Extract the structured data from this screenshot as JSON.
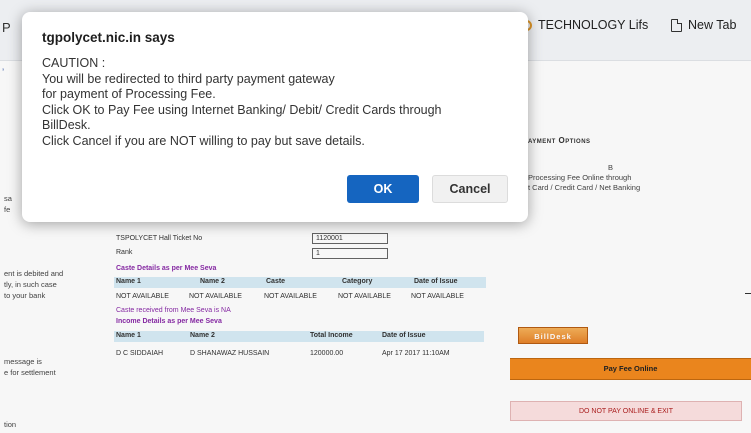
{
  "browser": {
    "left_fragment": "P",
    "left_fragment2": "ʼ",
    "bookmarks": [
      {
        "label": "TECHNOLOGY Lifs",
        "icon": "circle-icon"
      },
      {
        "label": "New Tab",
        "icon": "document-icon"
      }
    ]
  },
  "dialog": {
    "title": "tgpolycet.nic.in says",
    "lines": [
      "CAUTION :",
      "You will be redirected to third party payment gateway",
      "for payment of Processing Fee.",
      "Click OK to Pay Fee using Internet Banking/ Debit/ Credit Cards through",
      "BillDesk.",
      "Click Cancel if you are NOT willing to pay but save details."
    ],
    "ok_label": "OK",
    "cancel_label": "Cancel"
  },
  "page": {
    "payment_options_heading": "ayment Options",
    "payment_note": [
      "B",
      "Processing Fee Online through",
      "t Card / Credit Card / Net Banking"
    ],
    "left_fragments": [
      "sa",
      "fe",
      "ent is debited and",
      "tly, in such case",
      "to your bank",
      "message is",
      "e for settlement",
      "tion"
    ],
    "hall_ticket_label": "TSPOLYCET Hall Ticket No",
    "hall_ticket_value": "1120001",
    "rank_label": "Rank",
    "rank_value": "1",
    "caste_title": "Caste Details as per Mee Seva",
    "caste_headers": [
      "Name 1",
      "Name 2",
      "Caste",
      "Category",
      "Date of Issue"
    ],
    "caste_row": [
      "NOT AVAILABLE",
      "NOT AVAILABLE",
      "NOT AVAILABLE",
      "NOT AVAILABLE",
      "NOT AVAILABLE"
    ],
    "caste_note": "Caste received from Mee Seva is NA",
    "income_title": "Income Details as per Mee Seva",
    "income_headers": [
      "Name 1",
      "Name 2",
      "Total Income",
      "Date of Issue"
    ],
    "income_row": [
      "D C SIDDAIAH",
      "D SHANAWAZ HUSSAIN",
      "120000.00",
      "Apr 17 2017 11:10AM"
    ],
    "billdesk_label": "BillDesk",
    "pay_online_label": "Pay Fee Online",
    "do_not_pay_label": "DO NOT PAY ONLINE & EXIT"
  }
}
